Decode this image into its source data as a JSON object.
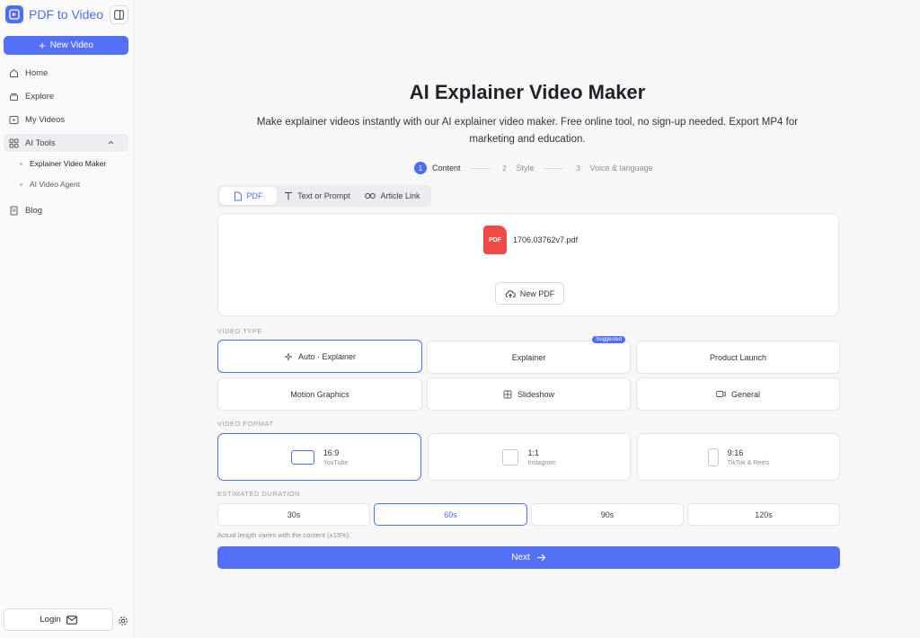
{
  "app": {
    "name": "PDF to Video"
  },
  "sidebar": {
    "new_video_label": "New Video",
    "items": [
      {
        "label": "Home",
        "icon": "home-icon"
      },
      {
        "label": "Explore",
        "icon": "stack-icon"
      },
      {
        "label": "My Videos",
        "icon": "video-icon"
      },
      {
        "label": "AI Tools",
        "icon": "grid-icon",
        "expanded": true
      },
      {
        "label": "Blog",
        "icon": "document-icon"
      }
    ],
    "sub_items": [
      {
        "label": "Explainer Video Maker",
        "active": true
      },
      {
        "label": "AI Video Agent",
        "active": false
      }
    ],
    "login_label": "Login"
  },
  "main": {
    "title": "AI Explainer Video Maker",
    "subtitle": "Make explainer videos instantly with our AI explainer video maker. Free online tool, no sign-up needed. Export MP4 for marketing and education.",
    "steps": [
      {
        "num": "1",
        "label": "Content",
        "active": true
      },
      {
        "num": "2",
        "label": "Style",
        "active": false
      },
      {
        "num": "3",
        "label": "Voice & language",
        "active": false
      }
    ],
    "tabs": [
      {
        "label": "PDF",
        "active": true
      },
      {
        "label": "Text or Prompt",
        "active": false
      },
      {
        "label": "Article Link",
        "active": false
      }
    ],
    "upload": {
      "file_badge": "PDF",
      "file_name": "1706.03762v7.pdf",
      "new_pdf_label": "New PDF"
    },
    "video_type": {
      "label": "VIDEO TYPE",
      "options": [
        {
          "label": "Auto · Explainer",
          "selected": true
        },
        {
          "label": "Explainer",
          "badge": "Suggested"
        },
        {
          "label": "Product Launch"
        },
        {
          "label": "Motion Graphics"
        },
        {
          "label": "Slideshow"
        },
        {
          "label": "General"
        }
      ]
    },
    "video_format": {
      "label": "VIDEO FORMAT",
      "options": [
        {
          "ratio": "16:9",
          "platform": "YouTube",
          "selected": true
        },
        {
          "ratio": "1:1",
          "platform": "Instagram"
        },
        {
          "ratio": "9:16",
          "platform": "TikTok & Reels"
        }
      ]
    },
    "duration": {
      "label": "ESTIMATED DURATION",
      "options": [
        "30s",
        "60s",
        "90s",
        "120s"
      ],
      "selected": "60s",
      "note": "Actual length varies with the content (±15%)."
    },
    "next_label": "Next"
  },
  "colors": {
    "accent": "#4f6df5",
    "pdf_red": "#ef4a46"
  }
}
